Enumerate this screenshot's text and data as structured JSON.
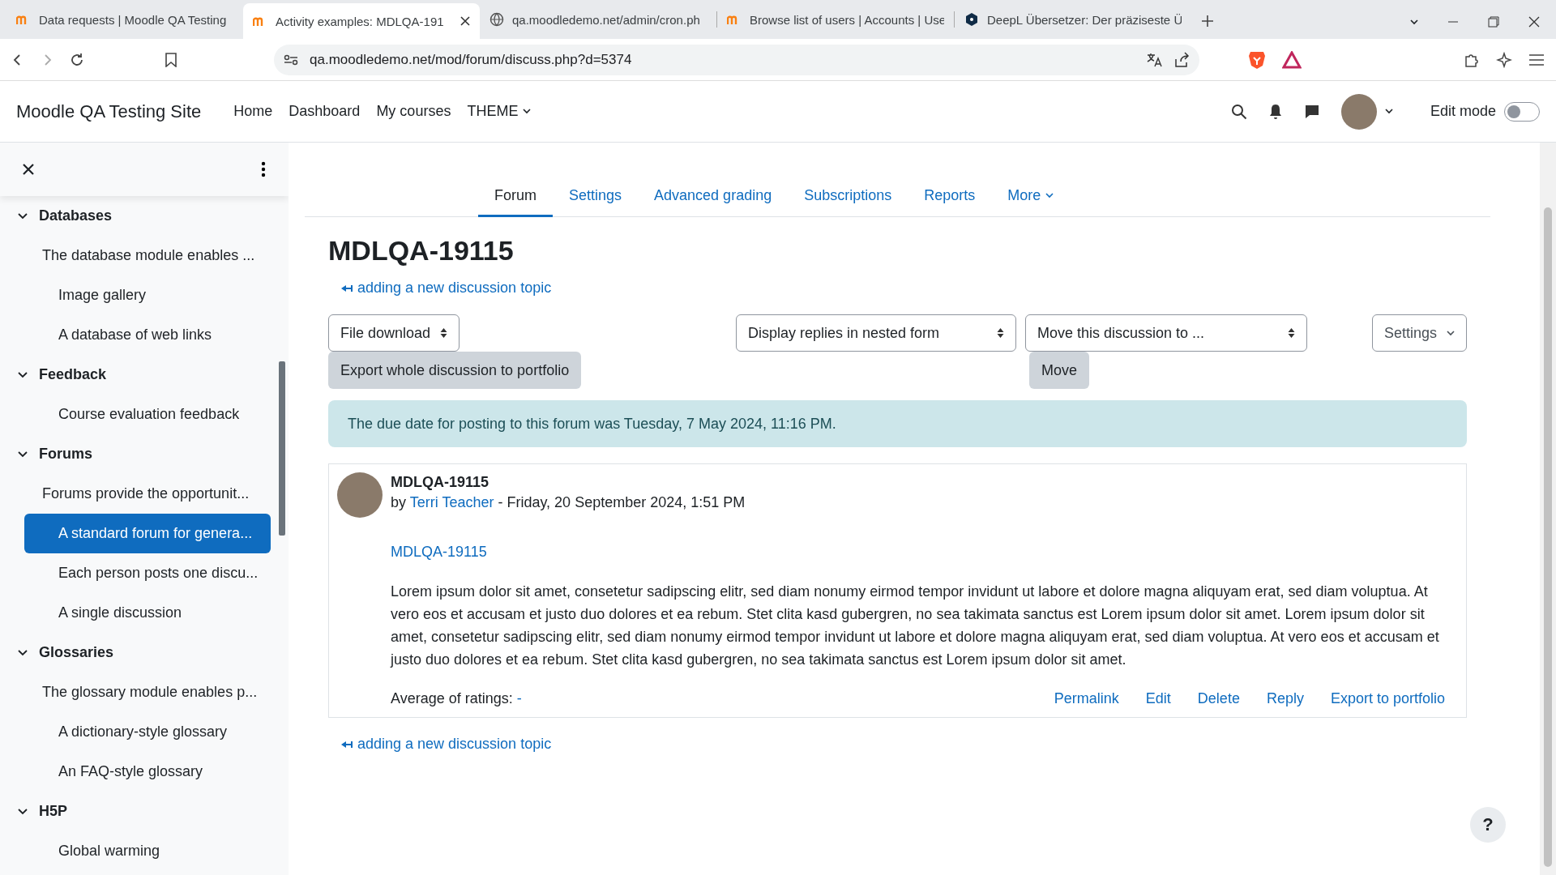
{
  "browser": {
    "tabs": [
      {
        "title": "Data requests | Moodle QA Testing",
        "kind": "moodle",
        "selected": false
      },
      {
        "title": "Activity examples: MDLQA-191",
        "kind": "moodle",
        "selected": true
      },
      {
        "title": "qa.moodledemo.net/admin/cron.ph",
        "kind": "globe",
        "selected": false
      },
      {
        "title": "Browse list of users | Accounts | Use",
        "kind": "moodle",
        "selected": false
      },
      {
        "title": "DeepL Übersetzer: Der präziseste Ü",
        "kind": "deepl",
        "selected": false
      }
    ],
    "url": "qa.moodledemo.net/mod/forum/discuss.php?d=5374"
  },
  "navbar": {
    "site_name": "Moodle QA Testing Site",
    "links": [
      {
        "label": "Home",
        "dropdown": false
      },
      {
        "label": "Dashboard",
        "dropdown": false
      },
      {
        "label": "My courses",
        "dropdown": false
      },
      {
        "label": "THEME",
        "dropdown": true
      }
    ],
    "edit_mode": {
      "label": "Edit mode",
      "on": false
    }
  },
  "sidebar": {
    "sections": [
      {
        "title": "Databases",
        "expanded": true,
        "items": [
          {
            "label": "The database module enables ...",
            "kind": "description",
            "selected": false
          },
          {
            "label": "Image gallery",
            "kind": "activity",
            "selected": false
          },
          {
            "label": "A database of web links",
            "kind": "activity",
            "selected": false
          }
        ]
      },
      {
        "title": "Feedback",
        "expanded": true,
        "items": [
          {
            "label": "Course evaluation feedback",
            "kind": "activity",
            "selected": false
          }
        ]
      },
      {
        "title": "Forums",
        "expanded": true,
        "items": [
          {
            "label": "Forums provide the opportunit...",
            "kind": "description",
            "selected": false
          },
          {
            "label": "A standard forum for genera...",
            "kind": "activity",
            "selected": true
          },
          {
            "label": "Each person posts one discu...",
            "kind": "activity",
            "selected": false
          },
          {
            "label": "A single discussion",
            "kind": "activity",
            "selected": false
          }
        ]
      },
      {
        "title": "Glossaries",
        "expanded": true,
        "items": [
          {
            "label": "The glossary module enables p...",
            "kind": "description",
            "selected": false
          },
          {
            "label": "A dictionary-style glossary",
            "kind": "activity",
            "selected": false
          },
          {
            "label": "An FAQ-style glossary",
            "kind": "activity",
            "selected": false
          }
        ]
      },
      {
        "title": "H5P",
        "expanded": true,
        "items": [
          {
            "label": "Global warming",
            "kind": "activity",
            "selected": false
          }
        ]
      }
    ]
  },
  "secondary_nav": [
    {
      "label": "Forum",
      "selected": true,
      "dropdown": false
    },
    {
      "label": "Settings",
      "selected": false,
      "dropdown": false
    },
    {
      "label": "Advanced grading",
      "selected": false,
      "dropdown": false
    },
    {
      "label": "Subscriptions",
      "selected": false,
      "dropdown": false
    },
    {
      "label": "Reports",
      "selected": false,
      "dropdown": false
    },
    {
      "label": "More",
      "selected": false,
      "dropdown": true
    }
  ],
  "heading": "MDLQA-19115",
  "back_link_top": "adding a new discussion topic",
  "controls": {
    "file_download": "File download",
    "display_mode": "Display replies in nested form",
    "move_to": "Move this discussion to ...",
    "settings": "Settings",
    "export_button": "Export whole discussion to portfolio",
    "move_button": "Move"
  },
  "alert": "The due date for posting to this forum was Tuesday, 7 May 2024, 11:16 PM.",
  "post": {
    "subject": "MDLQA-19115",
    "by": "by",
    "author": "Terri Teacher",
    "date": "- Friday, 20 September 2024, 1:51 PM",
    "title_link": "MDLQA-19115",
    "body": "Lorem ipsum dolor sit amet, consetetur sadipscing elitr, sed diam nonumy eirmod tempor invidunt ut labore et dolore magna aliquyam erat, sed diam voluptua. At vero eos et accusam et justo duo dolores et ea rebum. Stet clita kasd gubergren, no sea takimata sanctus est Lorem ipsum dolor sit amet. Lorem ipsum dolor sit amet, consetetur sadipscing elitr, sed diam nonumy eirmod tempor invidunt ut labore et dolore magna aliquyam erat, sed diam voluptua. At vero eos et accusam et justo duo dolores et ea rebum. Stet clita kasd gubergren, no sea takimata sanctus est Lorem ipsum dolor sit amet.",
    "ratings_label": "Average of ratings:",
    "ratings_value": "-",
    "actions": [
      "Permalink",
      "Edit",
      "Delete",
      "Reply",
      "Export to portfolio"
    ]
  },
  "back_link_bottom": "adding a new discussion topic",
  "help": "?"
}
